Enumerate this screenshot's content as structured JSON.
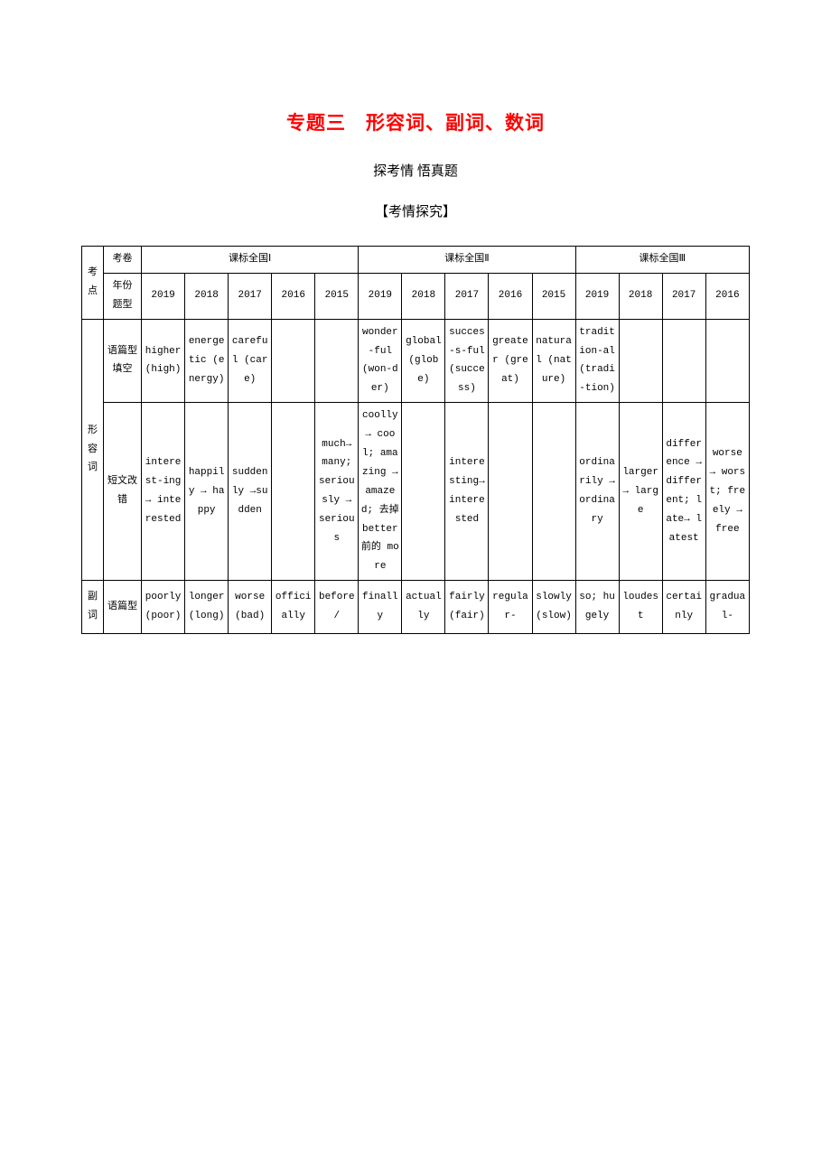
{
  "title": "专题三　形容词、副词、数词",
  "subtitle": "探考情 悟真题",
  "section": "【考情探究】",
  "head": {
    "kaodian": "考点",
    "juanzhen": "考卷",
    "nianfen": "年份",
    "tixing": "题型",
    "g1": "课标全国Ⅰ",
    "g2": "课标全国Ⅱ",
    "g3": "课标全国Ⅲ",
    "y2019": "2019",
    "y2018": "2018",
    "y2017": "2017",
    "y2016": "2016",
    "y2015": "2015"
  },
  "rows": {
    "adj": "形容词",
    "adv": "副词",
    "fill": "语篇型填空",
    "err": "短文改错",
    "fill2": "语篇型"
  },
  "adj_fill": {
    "g1_2019": "higher (high)",
    "g1_2018": "energetic (energy)",
    "g1_2017": "careful (care)",
    "g1_2016": "",
    "g1_2015": "",
    "g2_2019": "wonder-ful (won-der)",
    "g2_2018": "global (globe)",
    "g2_2017": "succes-s-ful (success)",
    "g2_2016": "greater (great)",
    "g2_2015": "natural (nature)",
    "g3_2019": "tradition-al (tradi-tion)",
    "g3_2018": "",
    "g3_2017": "",
    "g3_2016": ""
  },
  "adj_err": {
    "g1_2019": "interest-ing → interested",
    "g1_2018": "happily → happy",
    "g1_2017": "suddenly →sudden",
    "g1_2016": "",
    "g1_2015": "much→ many; seriously → serious",
    "g2_2019": "coolly → cool; amazing → amazed; 去掉 better 前的 more",
    "g2_2018": "",
    "g2_2017": "interesting→ interested",
    "g2_2016": "",
    "g2_2015": "",
    "g3_2019": "ordinarily → ordinary",
    "g3_2018": "larger → large",
    "g3_2017": "difference → different; late→ latest",
    "g3_2016": "worse → worst; freely → free"
  },
  "adv_fill": {
    "g1_2019": "poorly (poor)",
    "g1_2018": "longer (long)",
    "g1_2017": "worse (bad)",
    "g1_2016": "officially",
    "g1_2015": "before /",
    "g2_2019": "finally",
    "g2_2018": "actually",
    "g2_2017": "fairly (fair)",
    "g2_2016": "regular-",
    "g2_2015": "slowly (slow)",
    "g3_2019": "so; hugely",
    "g3_2018": "loudest",
    "g3_2017": "certainly",
    "g3_2016": "gradual-"
  }
}
